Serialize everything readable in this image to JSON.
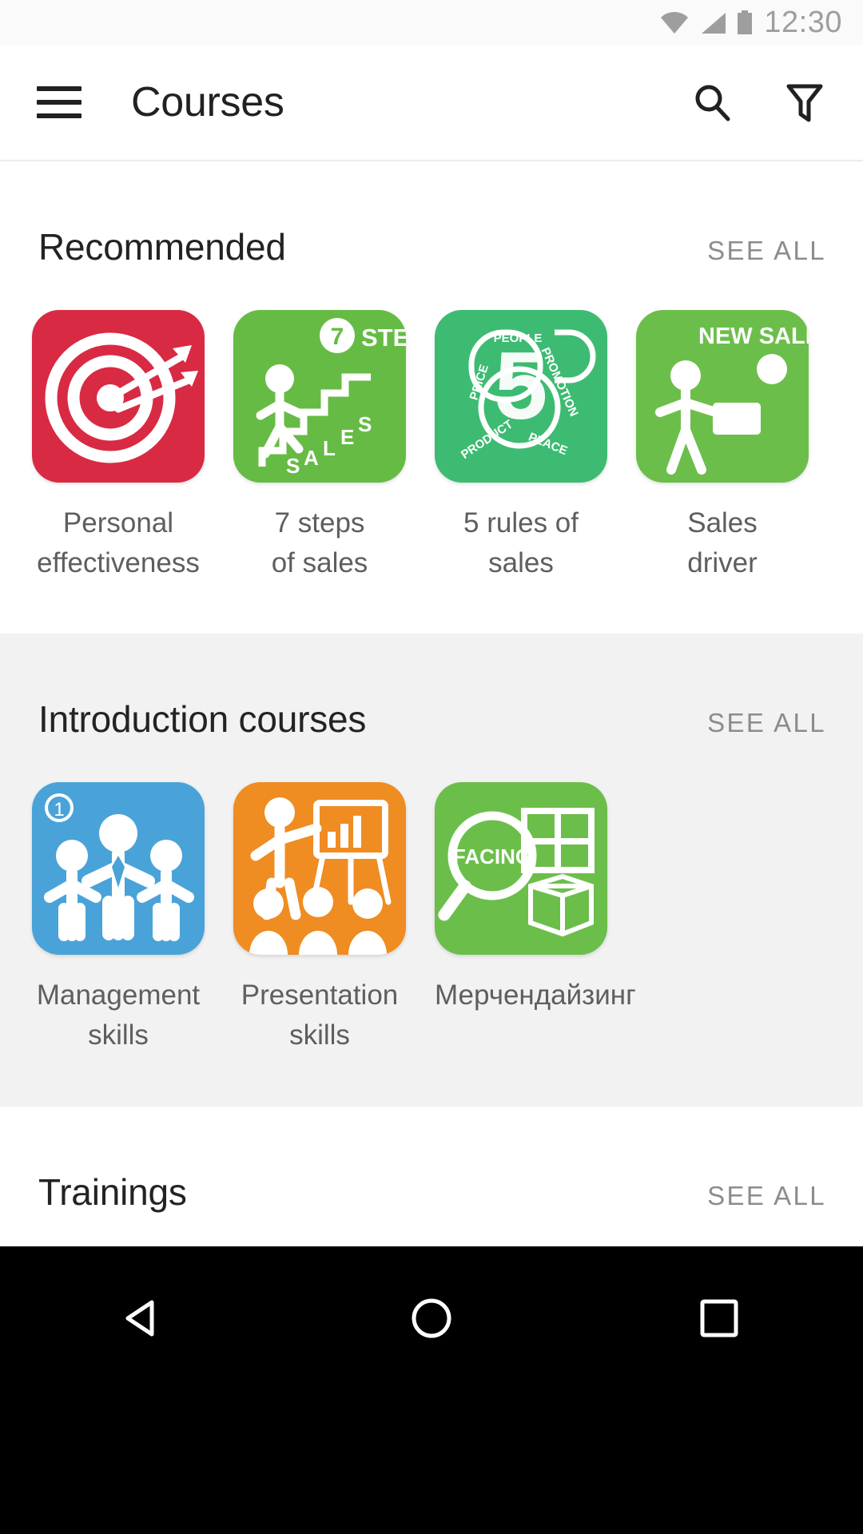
{
  "status_bar": {
    "time": "12:30",
    "icons": [
      "wifi-icon",
      "cellular-signal-icon",
      "battery-icon"
    ]
  },
  "app_bar": {
    "menu_icon": "hamburger-menu-icon",
    "title": "Courses",
    "search_icon": "search-icon",
    "filter_icon": "filter-icon"
  },
  "sections": [
    {
      "title": "Recommended",
      "see_all": "SEE ALL",
      "background": "#ffffff",
      "courses": [
        {
          "label": "Personal\neffectiveness",
          "tile_color": "#d92a44",
          "art": "target-arrows"
        },
        {
          "label": "7 steps\nof sales",
          "tile_color": "#66bb45",
          "art": "seven-steps",
          "art_text": {
            "badge": "7",
            "heading": "STEPS",
            "stairs": "SALES"
          }
        },
        {
          "label": "5 rules of\nsales",
          "tile_color": "#3dbb72",
          "art": "five-rules",
          "art_text": {
            "digit": "5",
            "words": [
              "PEOPLE",
              "PRICE",
              "PROMOTION",
              "PRODUCT",
              "PLACE"
            ]
          }
        },
        {
          "label": "Sales\ndriver",
          "tile_color": "#6cbe4b",
          "art": "sales-driver",
          "art_text": {
            "heading": "NEW SALES"
          }
        }
      ]
    },
    {
      "title": "Introduction courses",
      "see_all": "SEE ALL",
      "background": "#f2f2f2",
      "courses": [
        {
          "label": "Management\nskills",
          "tile_color": "#4aa3d8",
          "art": "team-people",
          "art_text": {
            "badge": "1"
          }
        },
        {
          "label": "Presentation\nskills",
          "tile_color": "#ef8c22",
          "art": "presenter-flipchart"
        },
        {
          "label": "Мерчендайзинг",
          "tile_color": "#6cbe4b",
          "art": "facing-magnifier",
          "art_text": {
            "heading": "FACING"
          }
        }
      ]
    },
    {
      "title": "Trainings",
      "see_all": "SEE ALL",
      "background": "#ffffff",
      "courses": []
    }
  ],
  "nav_bar": {
    "back": "back-triangle-icon",
    "home": "home-circle-icon",
    "recents": "recents-square-icon"
  },
  "colors": {
    "status_text": "#9e9e9e",
    "title_text": "#212121",
    "section_title": "#232323",
    "see_all": "#8c8c8c",
    "label_text": "#5e5e5e",
    "gray_section_bg": "#f2f2f2",
    "nav_bg": "#000000"
  }
}
